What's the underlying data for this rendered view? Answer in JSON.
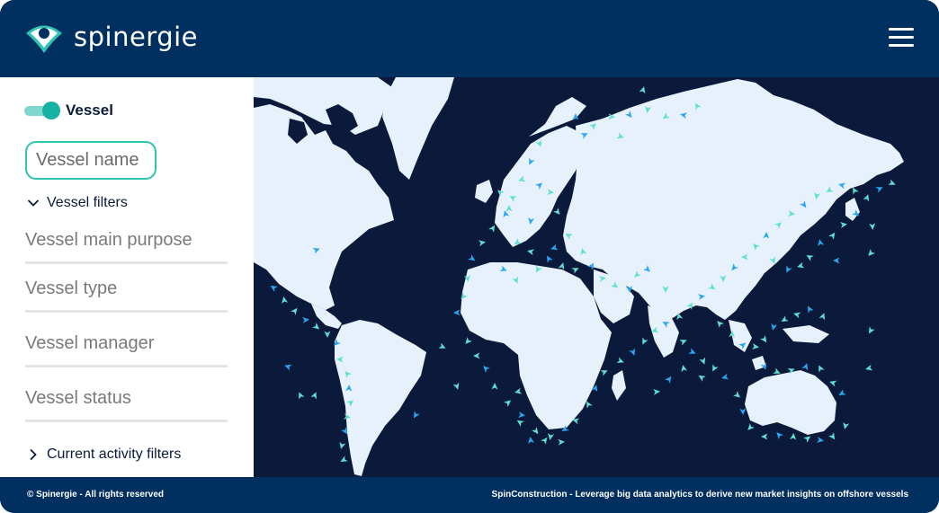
{
  "header": {
    "brand": "spinergie",
    "logo_icon": "location-pin-eye-icon",
    "menu_icon": "hamburger-menu-icon"
  },
  "colors": {
    "header_bg": "#003060",
    "accent": "#2ec4b3",
    "ocean": "#0b1a3a",
    "land": "#e6f1fb",
    "vessel_cyan": "#5fe0d2",
    "vessel_blue": "#2aa6f2"
  },
  "sidebar": {
    "vessel_toggle": {
      "label": "Vessel",
      "on": true
    },
    "search": {
      "placeholder": "Vessel name"
    },
    "vessel_filters": {
      "label": "Vessel filters",
      "expanded": true
    },
    "filters": [
      {
        "label": "Vessel main purpose"
      },
      {
        "label": "Vessel type"
      },
      {
        "label": "Vessel manager"
      },
      {
        "label": "Vessel status"
      }
    ],
    "activity_filters": {
      "label": "Current activity filters",
      "expanded": false
    }
  },
  "footer": {
    "copyright": "© Spinergie - All rights reserved",
    "tagline": "SpinConstruction - Leverage big data analytics to derive new market insights on offshore vessels"
  }
}
